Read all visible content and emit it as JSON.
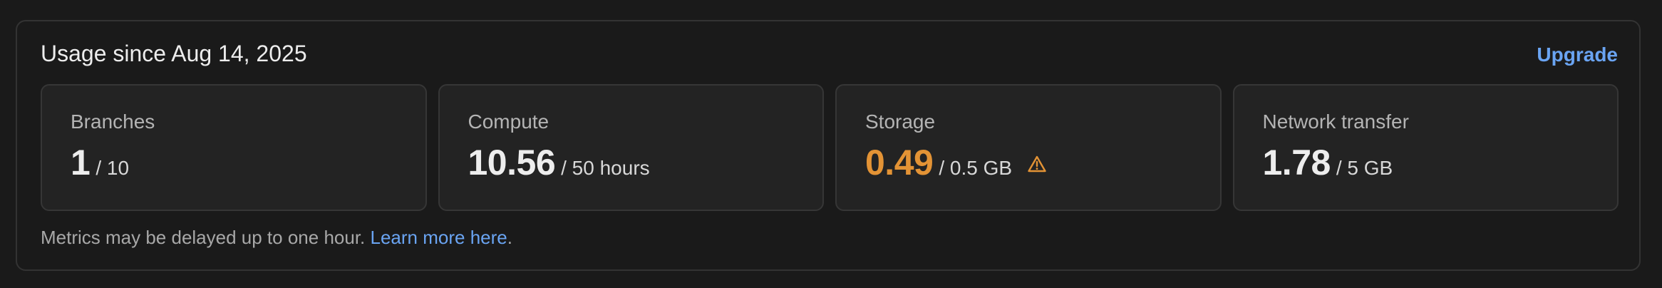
{
  "usage": {
    "title": "Usage since Aug 14, 2025",
    "upgrade_label": "Upgrade",
    "cards": [
      {
        "label": "Branches",
        "value": "1",
        "limit": "/ 10"
      },
      {
        "label": "Compute",
        "value": "10.56",
        "limit": "/ 50 hours"
      },
      {
        "label": "Storage",
        "value": "0.49",
        "limit": "/ 0.5 GB",
        "warning_icon": "warning-triangle-icon",
        "value_color": "#e39335"
      },
      {
        "label": "Network transfer",
        "value": "1.78",
        "limit": "/ 5 GB"
      }
    ],
    "footnote_text": "Metrics may be delayed up to one hour.",
    "footnote_link": "Learn more here",
    "footnote_end": "."
  },
  "colors": {
    "accent": "#6aa4f2",
    "warning": "#e39335",
    "background": "#1a1a1a",
    "card_background": "#232323"
  }
}
